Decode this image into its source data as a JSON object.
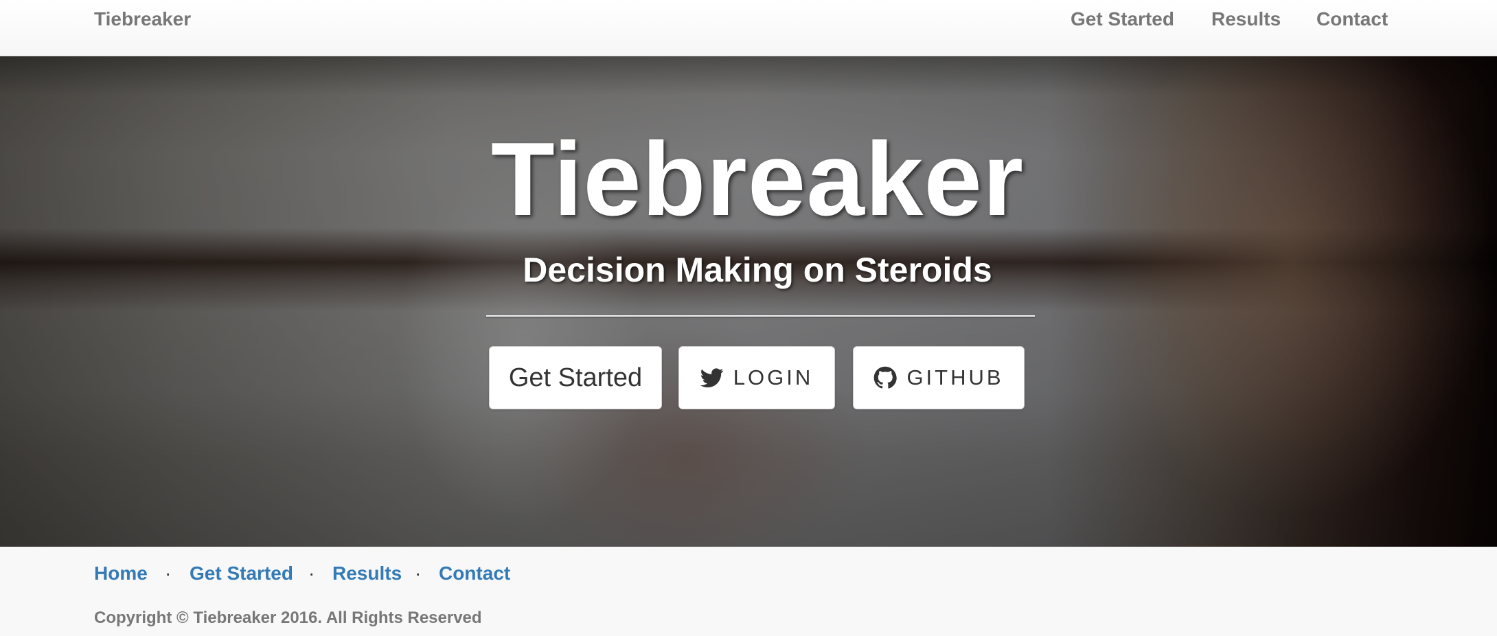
{
  "navbar": {
    "brand": "Tiebreaker",
    "links": [
      {
        "label": "Get Started"
      },
      {
        "label": "Results"
      },
      {
        "label": "Contact"
      }
    ]
  },
  "hero": {
    "title": "Tiebreaker",
    "subtitle": "Decision Making on Steroids",
    "buttons": {
      "get_started": "Get Started",
      "login": "LOGIN",
      "login_icon": "twitter-icon",
      "github": "GITHUB",
      "github_icon": "github-icon"
    }
  },
  "footer": {
    "links": [
      {
        "label": "Home"
      },
      {
        "label": "Get Started"
      },
      {
        "label": "Results"
      },
      {
        "label": "Contact"
      }
    ],
    "separator": "·",
    "copyright": "Copyright © Tiebreaker 2016. All Rights Reserved"
  },
  "colors": {
    "link_blue": "#337ab7",
    "nav_gray": "#777777",
    "footer_bg": "#f8f8f8"
  }
}
